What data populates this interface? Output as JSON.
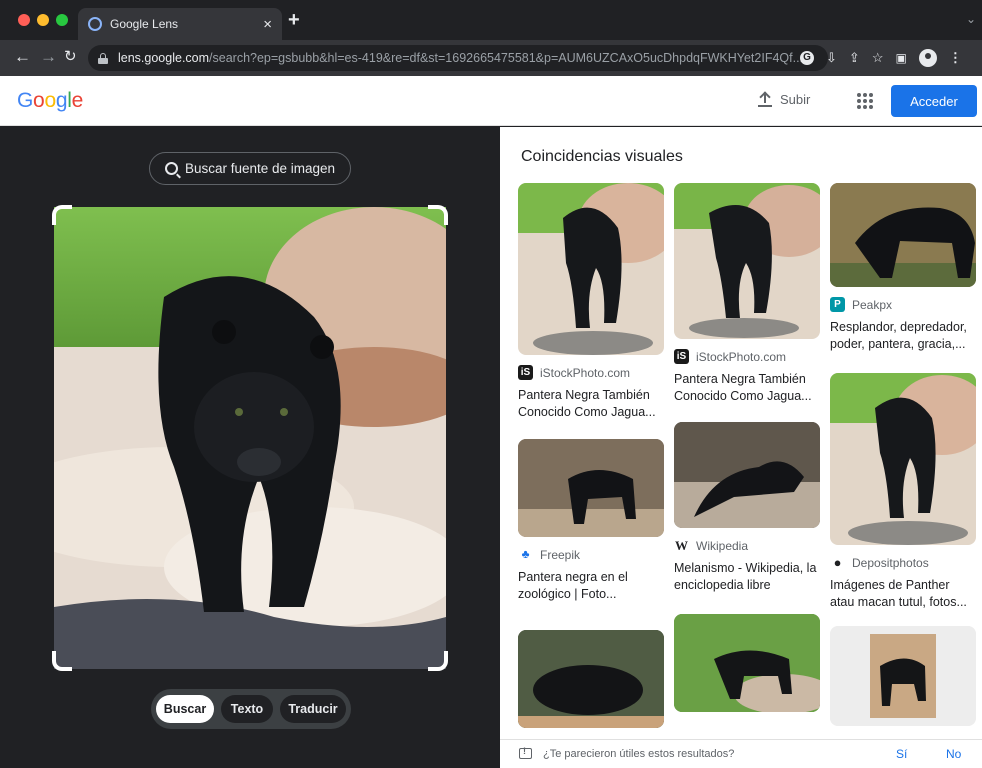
{
  "browser": {
    "tab_title": "Google Lens",
    "tab_close": "×",
    "new_tab": "+",
    "url_host": "lens.google.com",
    "url_path": "/search?ep=gsbubb&hl=es-419&re=df&st=1692665475581&p=AUM6UZCAxO5ucDhpdqFWKHYet2IF4Qf..."
  },
  "header": {
    "logo": "Google",
    "upload_label": "Subir",
    "signin_label": "Acceder"
  },
  "left": {
    "source_button": "Buscar fuente de imagen",
    "modes": [
      "Buscar",
      "Texto",
      "Traducir"
    ]
  },
  "results": {
    "title": "Coincidencias visuales",
    "cards": [
      {
        "source": "iStockPhoto.com",
        "caption": "Pantera Negra También Conocido Como Jagua..."
      },
      {
        "source": "iStockPhoto.com",
        "caption": "Pantera Negra También Conocido Como Jagua..."
      },
      {
        "source": "Peakpx",
        "caption": "Resplandor, depredador, poder, pantera, gracia,..."
      },
      {
        "source": "Freepik",
        "caption": "Pantera negra en el zoológico | Foto..."
      },
      {
        "source": "Wikipedia",
        "caption": "Melanismo - Wikipedia, la enciclopedia libre"
      },
      {
        "source": "Depositphotos",
        "caption": "Imágenes de Panther atau macan tutul, fotos..."
      }
    ]
  },
  "feedback": {
    "question": "¿Te parecieron útiles estos resultados?",
    "yes": "Sí",
    "no": "No"
  },
  "colors": {
    "accent": "#1a73e8",
    "dark_bg": "#202124"
  }
}
